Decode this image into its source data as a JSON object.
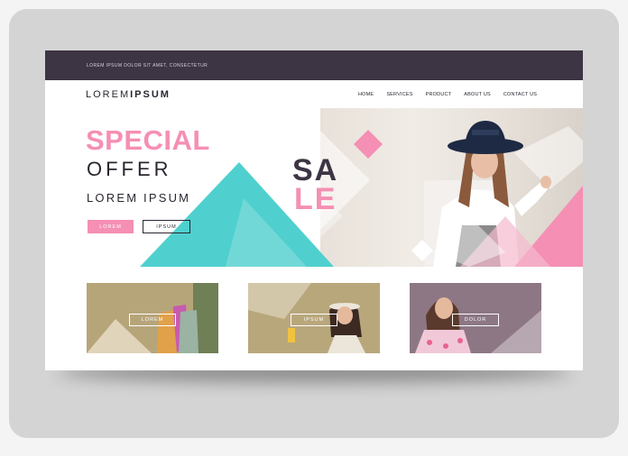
{
  "topbar": {
    "tagline": "LOREM IPSUM DOLOR SIT AMET, CONSECTETUR"
  },
  "logo": {
    "part1": "LOREM",
    "part2": "IPSUM"
  },
  "nav": [
    "HOME",
    "SERVICES",
    "PRODUCT",
    "ABOUT US",
    "CONTACT US"
  ],
  "hero": {
    "headline": "SPECIAL",
    "subheadline": "OFFER",
    "tagline": "LOREM IPSUM",
    "primary_button": "LOREM",
    "secondary_button": "IPSUM",
    "sale_line1": "SA",
    "sale_line2": "LE"
  },
  "cards": [
    {
      "button": "LOREM"
    },
    {
      "button": "IPSUM"
    },
    {
      "button": "DOLOR"
    }
  ],
  "colors": {
    "dark": "#3d3444",
    "pink": "#f58fb4",
    "teal": "#4fd0cf",
    "background": "#d4d4d4"
  }
}
